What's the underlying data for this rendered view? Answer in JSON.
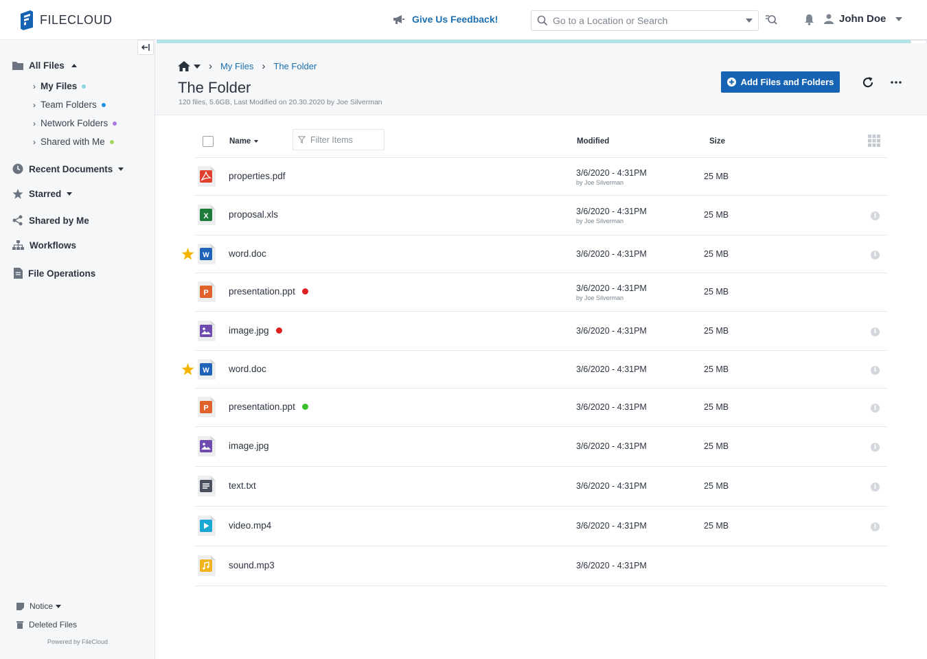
{
  "app": {
    "logo_text": "FILECLOUD"
  },
  "topbar": {
    "feedback_label": "Give Us Feedback!",
    "search_placeholder": "Go to a Location or Search",
    "user_name": "John Doe"
  },
  "sidebar": {
    "all_files": "All Files",
    "sub_items": [
      {
        "label": "My Files",
        "dot": "#8ed3e6",
        "bold": true
      },
      {
        "label": "Team Folders",
        "dot": "#1e90e0",
        "bold": false
      },
      {
        "label": "Network Folders",
        "dot": "#a97ae0",
        "bold": false
      },
      {
        "label": "Shared with Me",
        "dot": "#a4d65e",
        "bold": false
      }
    ],
    "recent": "Recent Documents",
    "starred": "Starred",
    "shared_by_me": "Shared by Me",
    "workflows": "Workflows",
    "file_operations": "File Operations",
    "notice": "Notice",
    "deleted_files": "Deleted Files",
    "powered_by": "Powered by FileCloud"
  },
  "header": {
    "breadcrumb": [
      "My Files",
      "The Folder"
    ],
    "title": "The Folder",
    "meta": "120 files, 5.6GB, Last Modified on 20.30.2020 by Joe Silverman",
    "add_button": "Add Files and Folders"
  },
  "table": {
    "col_name": "Name",
    "filter_placeholder": "Filter Items",
    "col_modified": "Modified",
    "col_size": "Size",
    "rows": [
      {
        "name": "properties.pdf",
        "type": "pdf",
        "modified": "3/6/2020 - 4:31PM",
        "by": "by Joe Silverman",
        "size": "25 MB",
        "starred": false,
        "dot": "",
        "info": false
      },
      {
        "name": "proposal.xls",
        "type": "xls",
        "modified": "3/6/2020 - 4:31PM",
        "by": "by Joe Silverman",
        "size": "25 MB",
        "starred": false,
        "dot": "",
        "info": true
      },
      {
        "name": "word.doc",
        "type": "doc",
        "modified": "3/6/2020 - 4:31PM",
        "by": "",
        "size": "25 MB",
        "starred": true,
        "dot": "",
        "info": true
      },
      {
        "name": "presentation.ppt",
        "type": "ppt",
        "modified": "3/6/2020 - 4:31PM",
        "by": "by Joe Silverman",
        "size": "25 MB",
        "starred": false,
        "dot": "#e02020",
        "info": false
      },
      {
        "name": "image.jpg",
        "type": "jpg",
        "modified": "3/6/2020 - 4:31PM",
        "by": "",
        "size": "25 MB",
        "starred": false,
        "dot": "#e02020",
        "info": true
      },
      {
        "name": "word.doc",
        "type": "doc",
        "modified": "3/6/2020 - 4:31PM",
        "by": "",
        "size": "25 MB",
        "starred": true,
        "dot": "",
        "info": true
      },
      {
        "name": "presentation.ppt",
        "type": "ppt",
        "modified": "3/6/2020 - 4:31PM",
        "by": "",
        "size": "25 MB",
        "starred": false,
        "dot": "#3cbf2a",
        "info": true
      },
      {
        "name": "image.jpg",
        "type": "jpg",
        "modified": "3/6/2020 - 4:31PM",
        "by": "",
        "size": "25 MB",
        "starred": false,
        "dot": "",
        "info": true
      },
      {
        "name": "text.txt",
        "type": "txt",
        "modified": "3/6/2020 - 4:31PM",
        "by": "",
        "size": "25 MB",
        "starred": false,
        "dot": "",
        "info": true
      },
      {
        "name": "video.mp4",
        "type": "mp4",
        "modified": "3/6/2020 - 4:31PM",
        "by": "",
        "size": "25 MB",
        "starred": false,
        "dot": "",
        "info": true
      },
      {
        "name": "sound.mp3",
        "type": "mp3",
        "modified": "3/6/2020 - 4:31PM",
        "by": "",
        "size": "",
        "starred": false,
        "dot": "",
        "info": false
      }
    ]
  },
  "colors": {
    "accent": "#1663b4",
    "link": "#1a6fb0",
    "teal_bar": "#b2e3e6",
    "star": "#f5b400"
  }
}
